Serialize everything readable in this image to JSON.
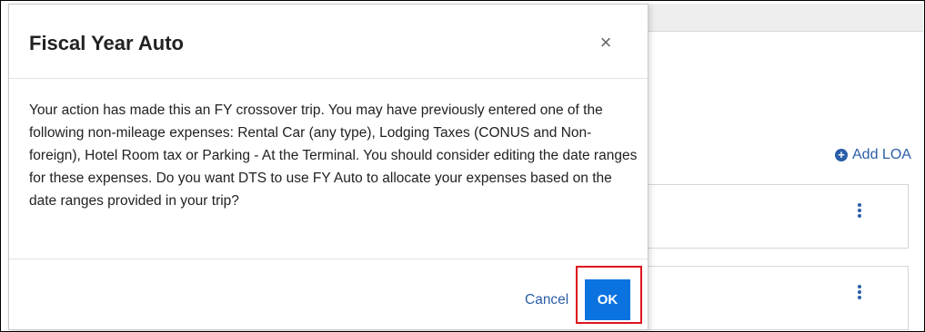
{
  "page": {
    "add_loa_label": "Add LOA",
    "accent_color": "#2a5ea8",
    "primary_button_color": "#0a73e0",
    "highlight_color": "#e0141e"
  },
  "dialog": {
    "title": "Fiscal Year Auto",
    "close_symbol": "×",
    "body_text": "Your action has made this an FY crossover trip. You may have previously entered one of the following non-mileage expenses: Rental Car (any type), Lodging Taxes (CONUS and Non-foreign), Hotel Room tax or Parking - At the Terminal. You should consider editing the date ranges for these expenses. Do you want DTS to use FY Auto to allocate your expenses based on the date ranges provided in your trip?",
    "cancel_label": "Cancel",
    "ok_label": "OK"
  },
  "icons": {
    "add": "plus-circle-icon",
    "close": "close-icon",
    "row_menu": "kebab-menu-icon"
  }
}
